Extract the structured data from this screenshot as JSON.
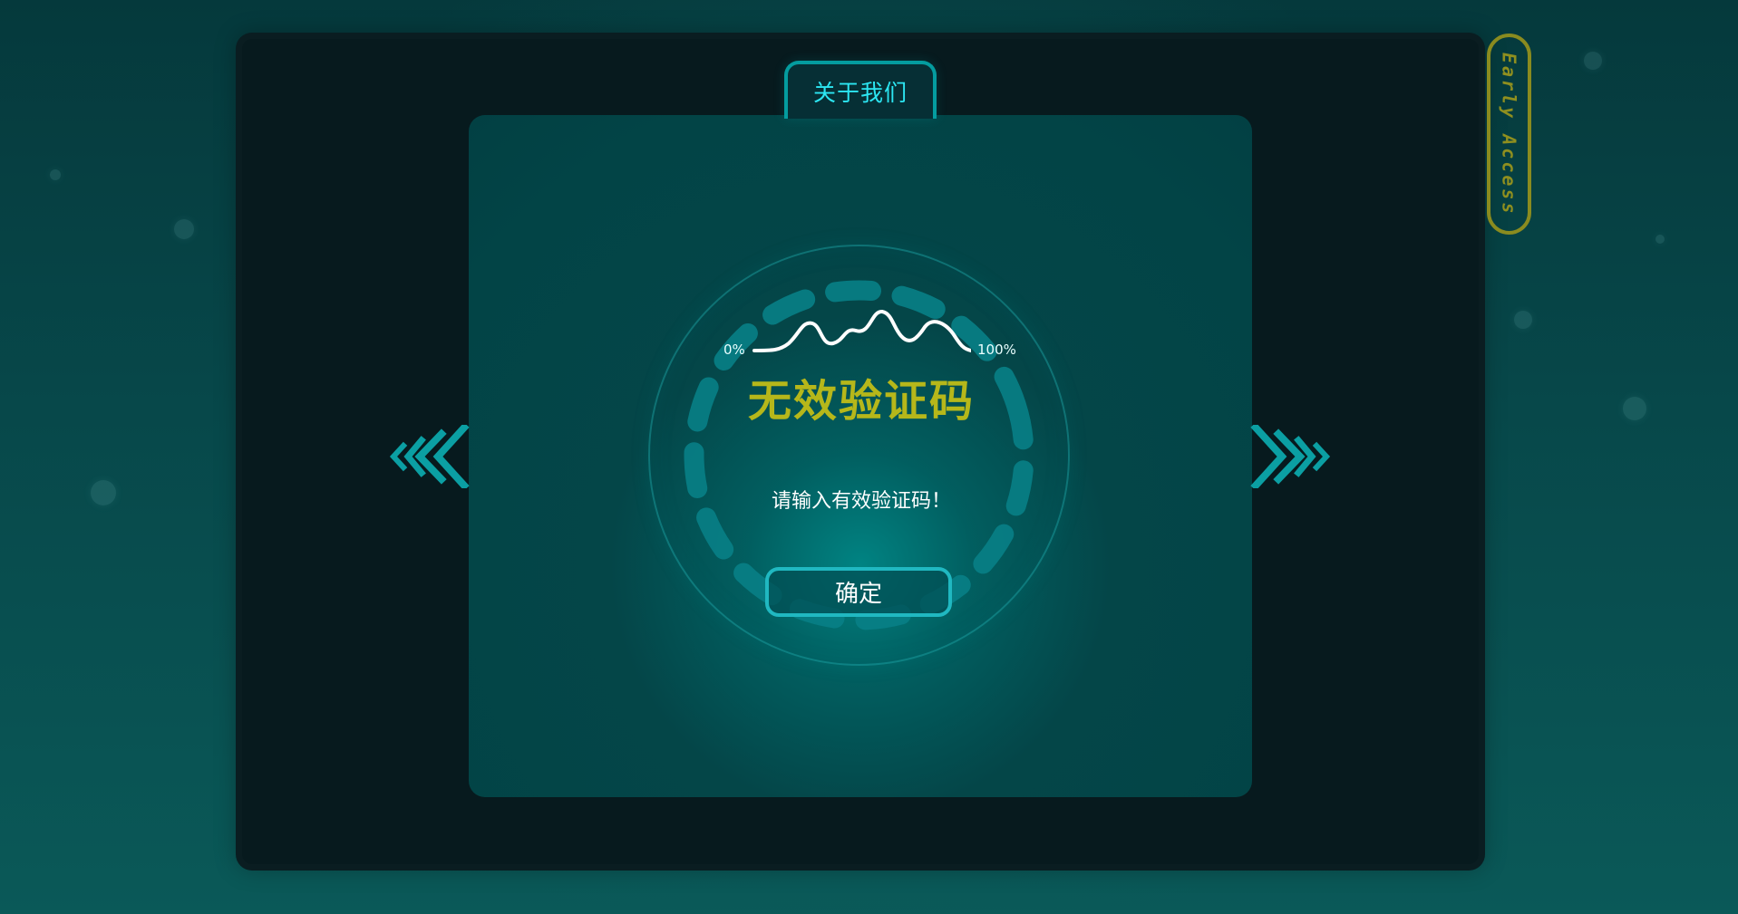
{
  "header": {
    "about_tab": "关于我们",
    "early_access": "Early Access"
  },
  "modal": {
    "progress_left_label": "0%",
    "progress_right_label": "100%",
    "title": "无效验证码",
    "message": "请输入有效验证码！",
    "confirm_label": "确定"
  },
  "navigation": {
    "left_icon": "chevron-left-icon",
    "right_icon": "chevron-right-icon"
  },
  "colors": {
    "background": "#063f41",
    "panel": "#024b4d",
    "accent_cyan": "#20b8c1",
    "title_yellow": "#b6b71a",
    "early_access": "#8a8b1f"
  }
}
